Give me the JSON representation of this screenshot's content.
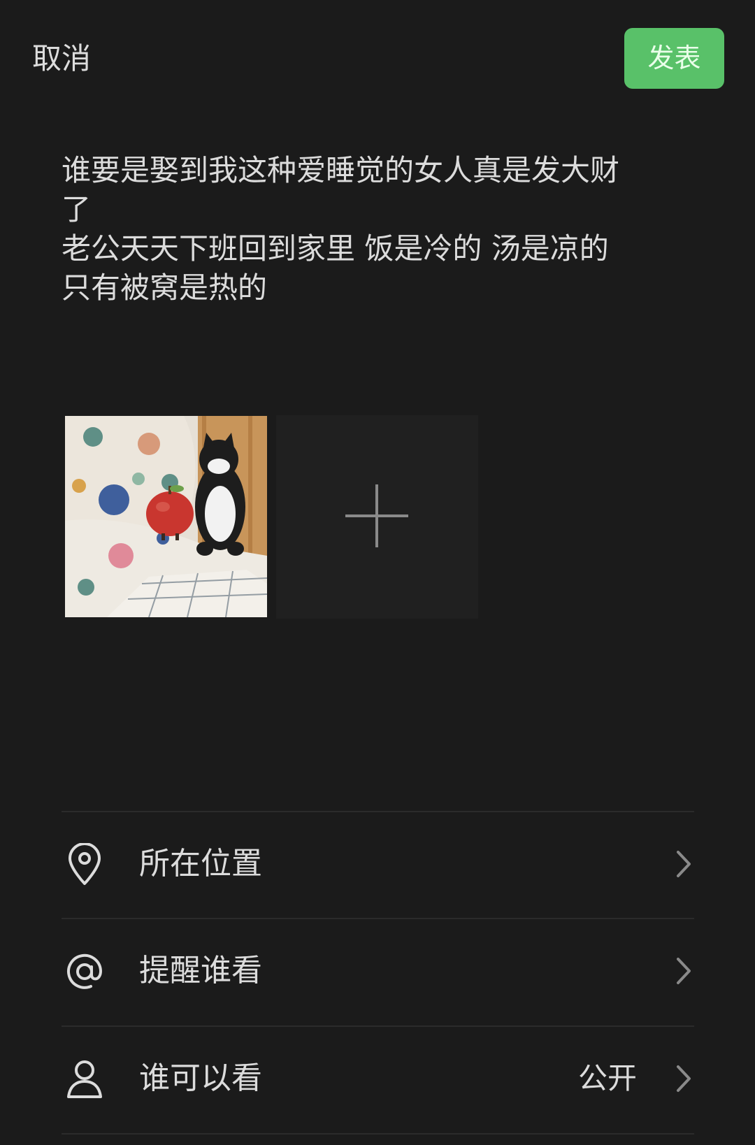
{
  "header": {
    "cancel_label": "取消",
    "publish_label": "发表"
  },
  "post": {
    "lines": [
      "谁要是娶到我这种爱睡觉的女人真是发大财",
      "了",
      "老公天天下班回到家里 饭是冷的 汤是凉的",
      "只有被窝是热的"
    ]
  },
  "photos": {
    "items": [
      {
        "icon": "photo-bed-plush-toys"
      }
    ],
    "add_icon": "plus-icon"
  },
  "options": [
    {
      "icon": "location-pin-icon",
      "label": "所在位置",
      "value": ""
    },
    {
      "icon": "at-sign-icon",
      "label": "提醒谁看",
      "value": ""
    },
    {
      "icon": "person-icon",
      "label": "谁可以看",
      "value": "公开"
    }
  ],
  "colors": {
    "background": "#1b1b1b",
    "accent": "#59c169",
    "text": "#dcdcdc",
    "divider": "#2b2b2b"
  }
}
